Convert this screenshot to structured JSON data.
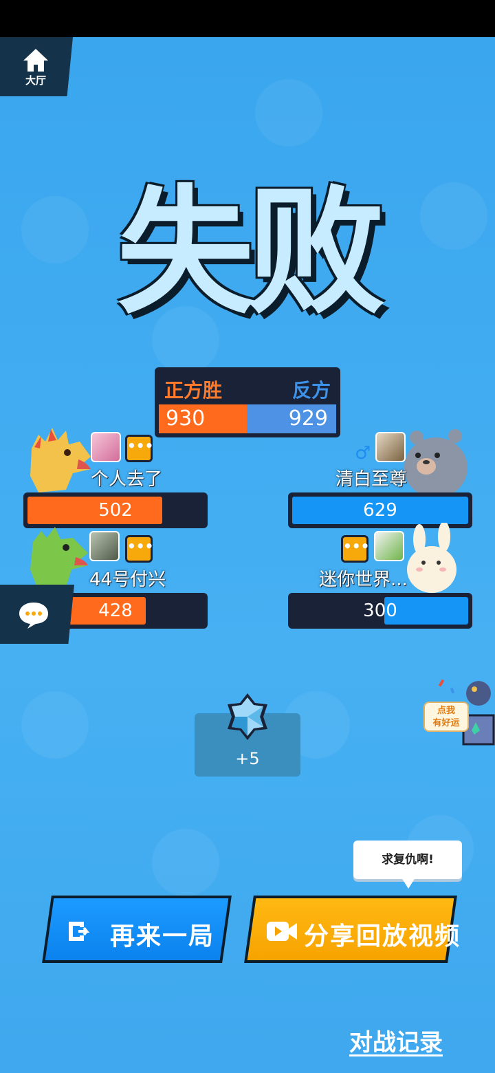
{
  "lobby": {
    "label": "大厅",
    "icon": "house-icon"
  },
  "result": {
    "title": "失败"
  },
  "scoreboard": {
    "winner_label": "正方胜",
    "loser_label": "反方",
    "left_score": "930",
    "right_score": "929",
    "left_color": "#ff6a1c",
    "right_color": "#4d92e4"
  },
  "players": [
    {
      "name": "个人去了",
      "score": "502",
      "fill_fraction": 0.78,
      "team": "left",
      "bar_color": "#ff6a1c"
    },
    {
      "name": "清白至尊",
      "score": "629",
      "fill_fraction": 1.0,
      "team": "right",
      "gender": "♂",
      "bar_color": "#1596f7"
    },
    {
      "name": "44号付兴",
      "score": "428",
      "fill_fraction": 0.67,
      "team": "left",
      "bar_color": "#ff6a1c"
    },
    {
      "name": "迷你世界...",
      "score": "300",
      "fill_fraction": 0.47,
      "team": "right",
      "bar_color": "#1596f7"
    }
  ],
  "chat_badge": "•••",
  "reward": {
    "value": "+5",
    "icon": "diamond-gem-icon"
  },
  "lucky": {
    "label": "点我\n有好运"
  },
  "speech": {
    "text": "求复仇啊!"
  },
  "buttons": {
    "again": "再来一局",
    "share": "分享回放视频"
  },
  "history_link": "对战记录"
}
